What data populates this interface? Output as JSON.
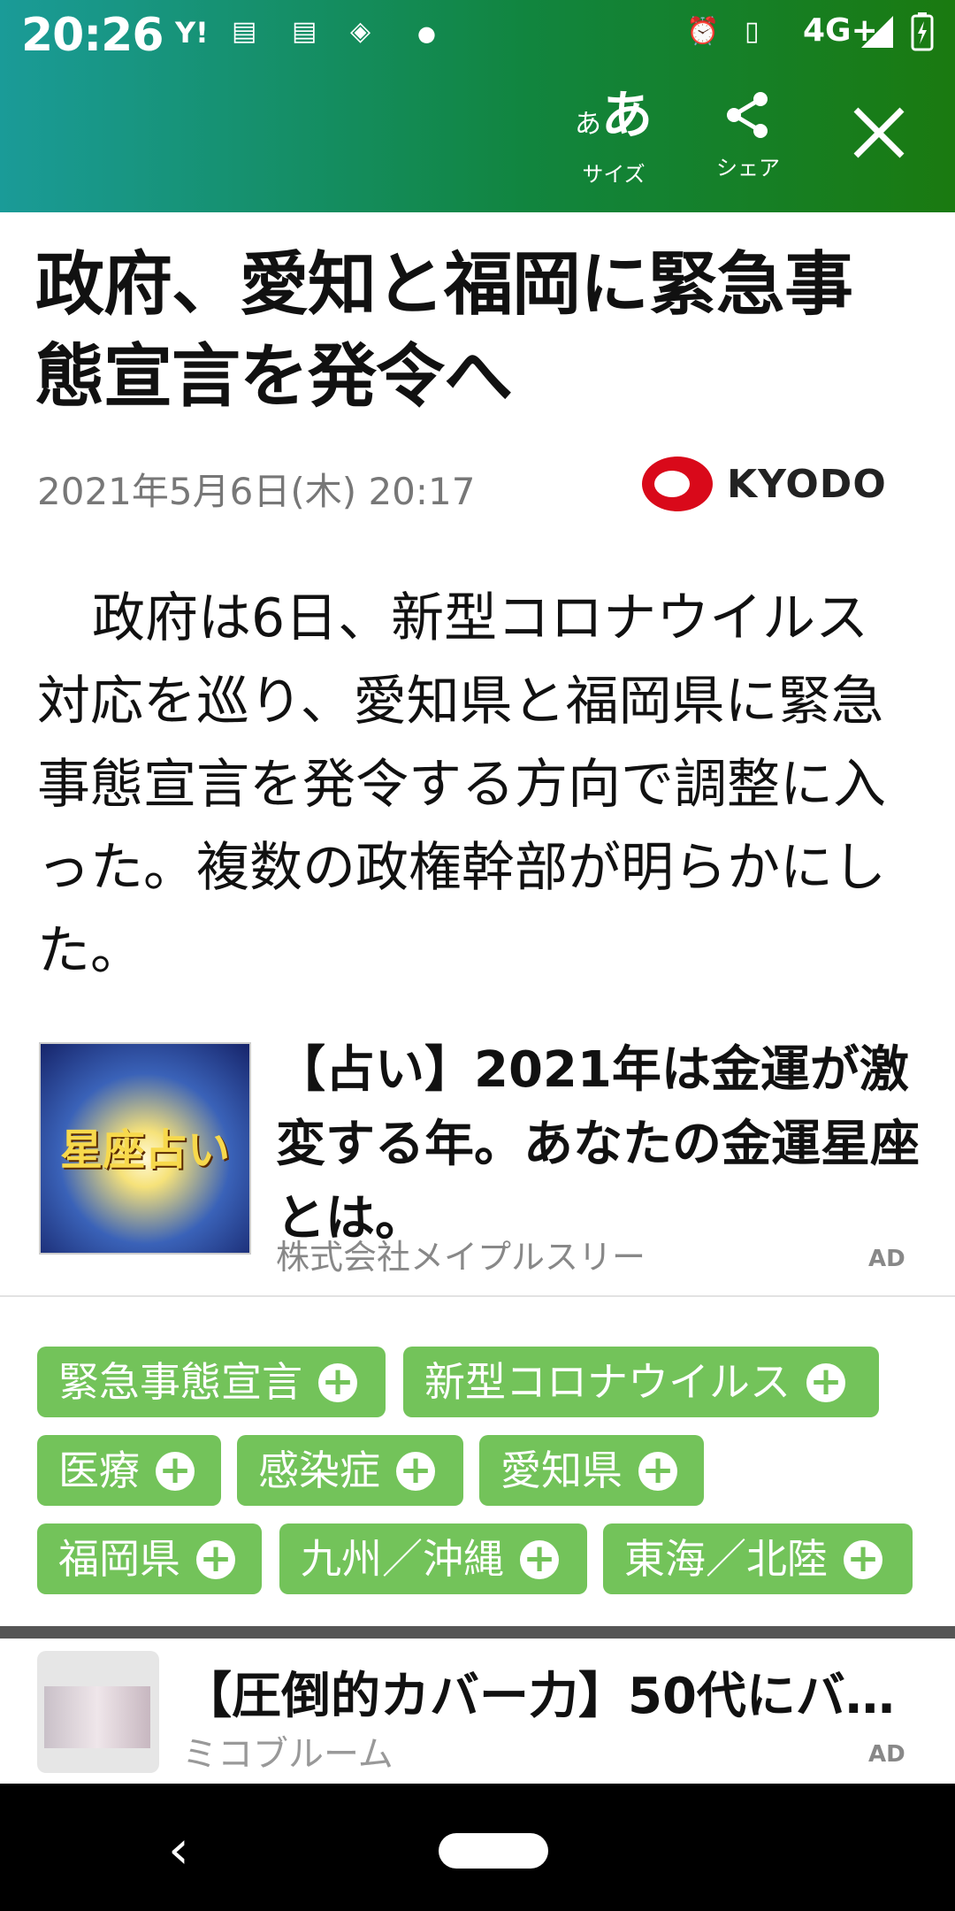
{
  "status_bar": {
    "time": "20:26",
    "network": "4G+",
    "icons": [
      "yahoo-icon",
      "dmenu-news-icon",
      "dmenu-news-icon",
      "app-icon",
      "dot-icon",
      "alarm-icon",
      "vibrate-icon",
      "signal-icon",
      "battery-icon"
    ]
  },
  "toolbar": {
    "size_glyph": "ああ",
    "size_label": "サイズ",
    "share_label": "シェア"
  },
  "article": {
    "headline": "政府、愛知と福岡に緊急事態宣言を発令へ",
    "date": "2021年5月6日(木) 20:17",
    "source": "KYODO",
    "body": "政府は6日、新型コロナウイルス対応を巡り、愛知県と福岡県に緊急事態宣言を発令する方向で調整に入った。複数の政権幹部が明らかにした。"
  },
  "ad1": {
    "thumb_text": "星座占い",
    "title": "【占い】2021年は金運が激変する年。あなたの金運星座とは。",
    "advertiser": "株式会社メイプルスリー",
    "ad_label": "AD"
  },
  "tags": [
    {
      "label": "緊急事態宣言"
    },
    {
      "label": "新型コロナウイルス"
    },
    {
      "label": "医療"
    },
    {
      "label": "感染症"
    },
    {
      "label": "愛知県"
    },
    {
      "label": "福岡県"
    },
    {
      "label": "九州／沖縄"
    },
    {
      "label": "東海／北陸"
    }
  ],
  "ad2": {
    "title": "【圧倒的カバー力】50代にバ…",
    "advertiser": "ミコブルーム",
    "ad_label": "AD"
  },
  "colors": {
    "tag_green": "#73c35a",
    "header_start": "#1a9b98",
    "header_end": "#1a7a10"
  }
}
